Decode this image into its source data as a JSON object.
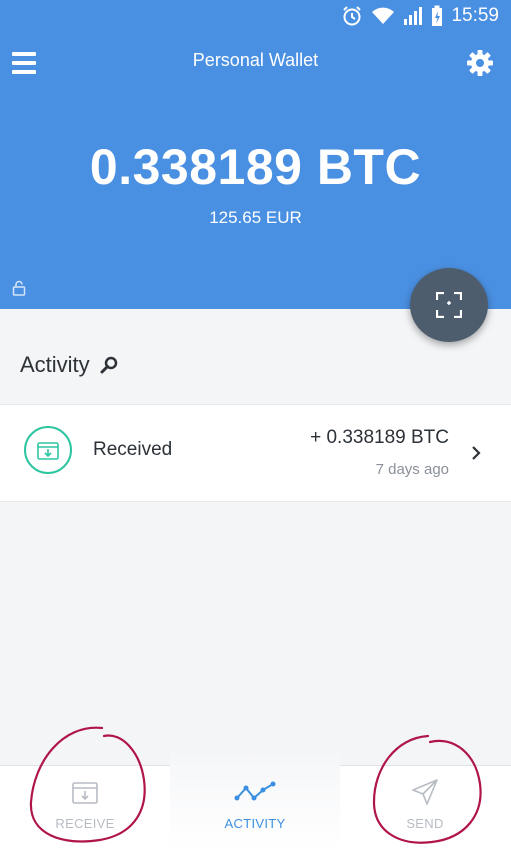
{
  "status_bar": {
    "time": "15:59"
  },
  "header": {
    "title": "Personal Wallet",
    "balance": "0.338189 BTC",
    "fiat_balance": "125.65 EUR"
  },
  "activity": {
    "heading": "Activity",
    "transactions": [
      {
        "type": "Received",
        "amount": "+ 0.338189 BTC",
        "time": "7 days ago"
      }
    ]
  },
  "bottom_nav": {
    "receive": "RECEIVE",
    "activity": "ACTIVITY",
    "send": "SEND",
    "active": "activity"
  },
  "colors": {
    "header_bg": "#4a90e2",
    "fab_bg": "#4d5d6e",
    "received_accent": "#2ec5a0",
    "nav_active": "#3b8fe0",
    "annotation_circle": "#b0154a"
  },
  "icons": [
    "alarm-icon",
    "wifi-icon",
    "signal-icon",
    "battery-icon",
    "menu-icon",
    "gear-icon",
    "lock-icon",
    "scan-icon",
    "search-icon",
    "receive-box-icon",
    "chevron-right-icon",
    "activity-graph-icon",
    "send-plane-icon"
  ]
}
